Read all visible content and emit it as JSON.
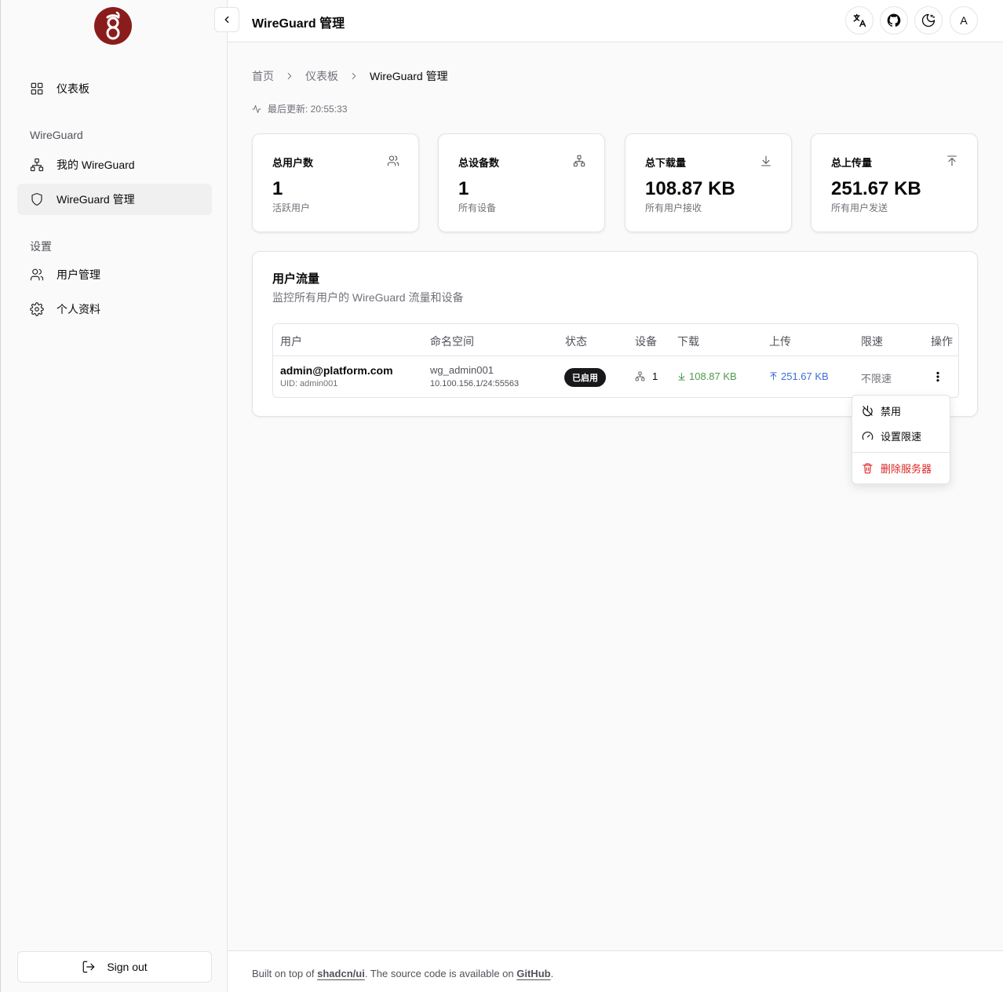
{
  "app": {
    "brand_color": "#8a1c1c"
  },
  "sidebar": {
    "items": [
      {
        "label": "仪表板",
        "icon": "grid-icon"
      },
      {
        "label": "我的 WireGuard",
        "icon": "network-icon"
      },
      {
        "label": "WireGuard 管理",
        "icon": "shield-icon"
      },
      {
        "label": "用户管理",
        "icon": "users-icon"
      },
      {
        "label": "个人资料",
        "icon": "gear-icon"
      }
    ],
    "groups": {
      "wireguard": "WireGuard",
      "settings": "设置"
    },
    "sign_out": "Sign out"
  },
  "header": {
    "title": "WireGuard 管理",
    "avatar_initial": "A"
  },
  "breadcrumb": [
    "首页",
    "仪表板",
    "WireGuard 管理"
  ],
  "last_update": "最后更新: 20:55:33",
  "stats": [
    {
      "title": "总用户数",
      "value": "1",
      "sub": "活跃用户",
      "icon": "users-icon"
    },
    {
      "title": "总设备数",
      "value": "1",
      "sub": "所有设备",
      "icon": "network-icon"
    },
    {
      "title": "总下载量",
      "value": "108.87 KB",
      "sub": "所有用户接收",
      "icon": "download-icon"
    },
    {
      "title": "总上传量",
      "value": "251.67 KB",
      "sub": "所有用户发送",
      "icon": "upload-icon"
    }
  ],
  "traffic": {
    "title": "用户流量",
    "description": "监控所有用户的 WireGuard 流量和设备",
    "columns": [
      "用户",
      "命名空间",
      "状态",
      "设备",
      "下载",
      "上传",
      "限速",
      "操作"
    ],
    "rows": [
      {
        "email": "admin@platform.com",
        "uid": "UID: admin001",
        "namespace": "wg_admin001",
        "cidr": "10.100.156.1/24:55563",
        "status": "已启用",
        "devices": "1",
        "download": "108.87 KB",
        "upload": "251.67 KB",
        "limit": "不限速"
      }
    ]
  },
  "menu": {
    "disable": "禁用",
    "set_limit": "设置限速",
    "delete": "删除服务器"
  },
  "footer": {
    "prefix": "Built on top of ",
    "link1": "shadcn/ui",
    "middle": ". The source code is available on ",
    "link2": "GitHub",
    "suffix": "."
  }
}
